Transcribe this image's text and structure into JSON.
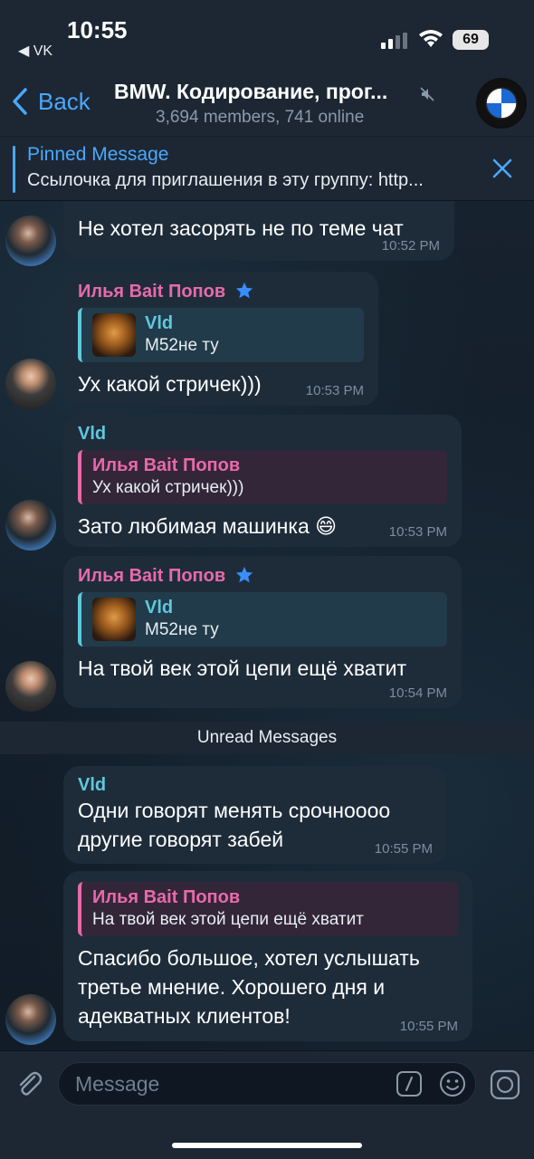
{
  "status": {
    "time": "10:55",
    "back_app": "◀ VK",
    "battery": "69"
  },
  "header": {
    "back_label": "Back",
    "title": "BMW. Кодирование, прог...",
    "subtitle": "3,694 members, 741 online"
  },
  "pinned": {
    "title": "Pinned Message",
    "text": "Ссылочка для приглашения в эту группу: http..."
  },
  "messages": [
    {
      "text": "Не хотел засорять не по теме чат",
      "time": "10:52 PM"
    },
    {
      "sender": "Илья Bait Попов",
      "reply_name": "Vld",
      "reply_text": "M52не ту",
      "text": "Ух какой стричек)))",
      "time": "10:53 PM"
    },
    {
      "sender": "Vld",
      "reply_name": "Илья Bait Попов",
      "reply_text": "Ух какой стричек)))",
      "text": "Зато любимая машинка 😄",
      "time": "10:53 PM"
    },
    {
      "sender": "Илья Bait Попов",
      "reply_name": "Vld",
      "reply_text": "M52не ту",
      "text": "На твой век этой цепи ещё хватит",
      "time": "10:54 PM"
    },
    {
      "sender": "Vld",
      "text_line1": "Одни говорят менять срочноооо",
      "text_line2": "другие говорят забей",
      "time": "10:55 PM"
    },
    {
      "reply_name": "Илья Bait Попов",
      "reply_text": "На твой век этой цепи ещё хватит",
      "text_line1": "Спасибо большое, хотел услышать",
      "text_line2": "третье мнение. Хорошего дня и",
      "text_line3": "адекватных клиентов!",
      "time": "10:55 PM"
    }
  ],
  "unread_label": "Unread Messages",
  "input": {
    "placeholder": "Message"
  },
  "colors": {
    "accent": "#4aa8ff",
    "sender_pink": "#e86aa8",
    "sender_cyan": "#5fc8dd"
  }
}
